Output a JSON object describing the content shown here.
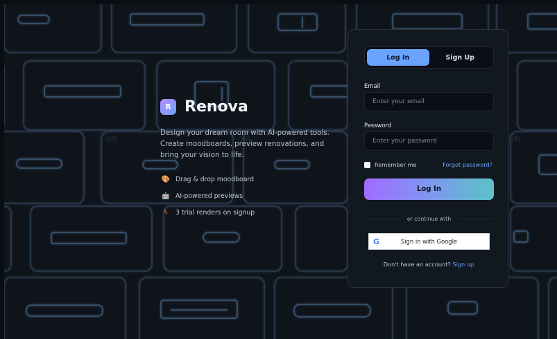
{
  "brand": {
    "logo_letter": "R",
    "name": "Renova",
    "tagline": "Design your dream room with AI-powered tools. Create moodboards, preview renovations, and bring your vision to life.",
    "features": [
      {
        "icon": "palette-icon",
        "text": "Drag & drop moodboard"
      },
      {
        "icon": "robot-icon",
        "text": "AI-powered previews"
      },
      {
        "icon": "lightning-icon",
        "text": "3 trial renders on signup"
      }
    ]
  },
  "background": {
    "obj_labels": [
      "OBJ",
      "OBJ",
      "OBJ"
    ]
  },
  "auth": {
    "tabs": [
      {
        "label": "Log In",
        "active": true
      },
      {
        "label": "Sign Up",
        "active": false
      }
    ],
    "email_label": "Email",
    "email_placeholder": "Enter your email",
    "password_label": "Password",
    "password_placeholder": "Enter your password",
    "remember_label": "Remember me",
    "forgot_label": "Forgot password?",
    "login_button": "Log In",
    "divider_text": "or continue with",
    "google_label": "Sign in with Google",
    "google_letter": "G",
    "signup_prompt": "Don't have an account?",
    "signup_link": "Sign up"
  },
  "colors": {
    "accent": "#6aa4ff",
    "glow": "#1f6fb0",
    "card_bg": "#121820",
    "page_bg": "#0f141a"
  }
}
